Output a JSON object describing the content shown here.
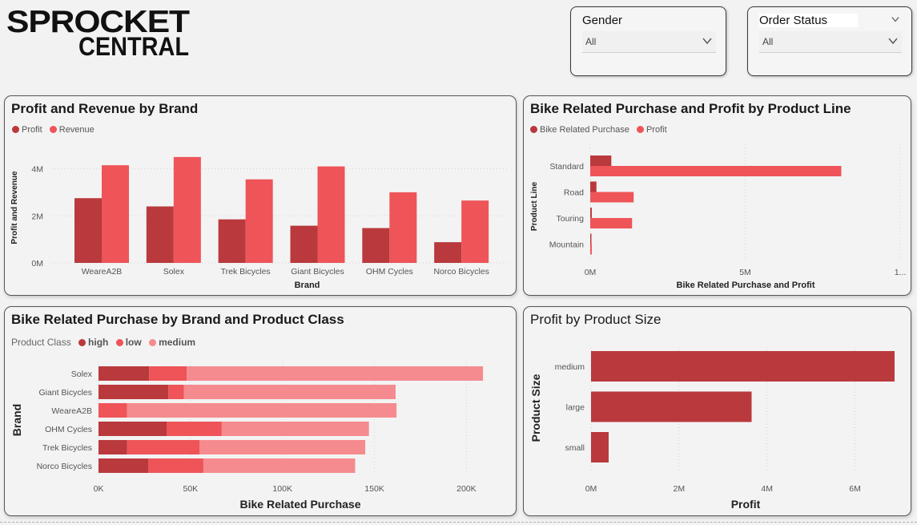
{
  "logo": {
    "line1": "SPROCKET",
    "line2": "CENTRAL"
  },
  "filters": {
    "gender": {
      "title": "Gender",
      "value": "All"
    },
    "order_status": {
      "title": "Order Status",
      "value": "All"
    }
  },
  "colors": {
    "dark": "#b9393c",
    "medium": "#ee5458",
    "light": "#f58b8e"
  },
  "cards": {
    "profit_revenue": {
      "title": "Profit and Revenue by Brand",
      "legend": [
        "Profit",
        "Revenue"
      ]
    },
    "product_line": {
      "title": "Bike Related Purchase and Profit by Product Line",
      "legend": [
        "Bike Related Purchase",
        "Profit"
      ]
    },
    "brand_class": {
      "title": "Bike Related Purchase by Brand and Product Class",
      "legend_title": "Product Class",
      "legend": [
        "high",
        "low",
        "medium"
      ]
    },
    "product_size": {
      "title": "Profit by Product Size"
    }
  },
  "chart_data": [
    {
      "type": "bar",
      "title": "Profit and Revenue by Brand",
      "xlabel": "Brand",
      "ylabel": "Profit and Revenue",
      "categories": [
        "WeareA2B",
        "Solex",
        "Trek Bicycles",
        "Giant Bicycles",
        "OHM Cycles",
        "Norco Bicycles"
      ],
      "series": [
        {
          "name": "Profit",
          "values": [
            2.75,
            2.4,
            1.85,
            1.58,
            1.48,
            0.88
          ]
        },
        {
          "name": "Revenue",
          "values": [
            4.15,
            4.5,
            3.55,
            4.1,
            3.0,
            2.65
          ]
        }
      ],
      "ylim": [
        0,
        4.7
      ],
      "yticks": [
        0,
        2,
        4
      ],
      "ytick_labels": [
        "0M",
        "2M",
        "4M"
      ],
      "unit": "M",
      "legend": "top-left",
      "grid": true
    },
    {
      "type": "bar",
      "orientation": "horizontal",
      "title": "Bike Related Purchase and Profit by Product Line",
      "xlabel": "Bike Related Purchase and Profit",
      "ylabel": "Product Line",
      "categories": [
        "Standard",
        "Road",
        "Touring",
        "Mountain"
      ],
      "series": [
        {
          "name": "Bike Related Purchase",
          "values": [
            0.68,
            0.2,
            0.05,
            0.01
          ]
        },
        {
          "name": "Profit",
          "values": [
            8.1,
            1.4,
            1.35,
            0.05
          ]
        }
      ],
      "xlim": [
        0,
        10
      ],
      "xticks": [
        0,
        5,
        10
      ],
      "xtick_labels": [
        "0M",
        "5M",
        "1..."
      ],
      "unit": "M",
      "legend": "top-left",
      "grid": true
    },
    {
      "type": "bar",
      "orientation": "horizontal",
      "stacked": true,
      "title": "Bike Related Purchase by Brand and Product Class",
      "xlabel": "Bike Related Purchase",
      "ylabel": "Brand",
      "categories": [
        "Solex",
        "Giant Bicycles",
        "WeareA2B",
        "OHM Cycles",
        "Trek Bicycles",
        "Norco Bicycles"
      ],
      "series": [
        {
          "name": "high",
          "values": [
            27500,
            38000,
            0,
            37000,
            15500,
            27000
          ]
        },
        {
          "name": "low",
          "values": [
            20500,
            8500,
            15500,
            30000,
            39500,
            30000
          ]
        },
        {
          "name": "medium",
          "values": [
            161000,
            115000,
            146500,
            80000,
            90000,
            82500
          ]
        }
      ],
      "xlim": [
        0,
        215000
      ],
      "xticks": [
        0,
        50000,
        100000,
        150000,
        200000
      ],
      "xtick_labels": [
        "0K",
        "50K",
        "100K",
        "150K",
        "200K"
      ],
      "legend": "top-left",
      "grid": true
    },
    {
      "type": "bar",
      "orientation": "horizontal",
      "title": "Profit by Product Size",
      "xlabel": "Profit",
      "ylabel": "Product Size",
      "categories": [
        "medium",
        "large",
        "small"
      ],
      "values": [
        6.9,
        3.65,
        0.4
      ],
      "xlim": [
        0,
        6.9
      ],
      "xticks": [
        0,
        2,
        4,
        6
      ],
      "xtick_labels": [
        "0M",
        "2M",
        "4M",
        "6M"
      ],
      "unit": "M",
      "grid": true
    }
  ]
}
